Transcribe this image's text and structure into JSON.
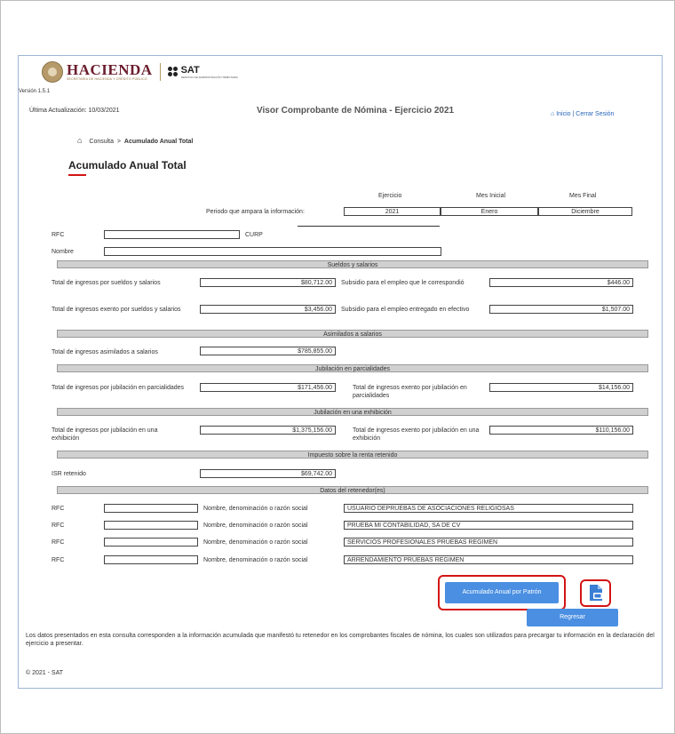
{
  "header": {
    "brand": "HACIENDA",
    "brand_sub": "SECRETARÍA DE HACIENDA Y CRÉDITO PÚBLICO",
    "sat": "SAT",
    "sat_sub": "SERVICIO DE ADMINISTRACIÓN TRIBUTARIA",
    "version": "Versión 1.5.1",
    "last_update": "Última Actualización: 10/03/2021",
    "app_title": "Visor Comprobante de Nómina - Ejercicio 2021",
    "inicio": "Inicio",
    "sep": "|",
    "cerrar": "Cerrar Sesión"
  },
  "breadcrumb": {
    "home": "Consulta",
    "current": "Acumulado Anual Total"
  },
  "page_title": "Acumulado Anual Total",
  "accent_color": "#d31414",
  "periodo": {
    "col_ejercicio": "Ejercicio",
    "col_mes_inicial": "Mes Inicial",
    "col_mes_final": "Mes Final",
    "label": "Periodo que ampara la información:",
    "ejercicio": "2021",
    "mes_inicial": "Enero",
    "mes_final": "Diciembre"
  },
  "contrib": {
    "rfc_label": "RFC",
    "rfc_value": "",
    "curp_label": "CURP",
    "curp_value": "",
    "nombre_label": "Nombre",
    "nombre_value": ""
  },
  "sueldos": {
    "title": "Sueldos y salarios",
    "total_label": "Total de ingresos por sueldos y salarios",
    "total_value": "$80,712.00",
    "subsidio_corr_label": "Subsidio para el empleo que le correspondió",
    "subsidio_corr_value": "$446.00",
    "exento_label": "Total de ingresos exento por sueldos y salarios",
    "exento_value": "$3,456.00",
    "subsidio_ent_label": "Subsidio para el empleo entregado en efectivo",
    "subsidio_ent_value": "$1,507.00"
  },
  "asimilados": {
    "title": "Asimilados a salarios",
    "total_label": "Total de ingresos asimilados a salarios",
    "total_value": "$785,855.00"
  },
  "jub_parc": {
    "title": "Jubilación en parcialidades",
    "total_label": "Total de ingresos por jubilación en parcialidades",
    "total_value": "$171,456.00",
    "exento_label": "Total de ingresos exento por jubilación en parcialidades",
    "exento_value": "$14,156.00"
  },
  "jub_exh": {
    "title": "Jubilación en una exhibición",
    "total_label": "Total de ingresos por jubilación en una exhibición",
    "total_value": "$1,375,156.00",
    "exento_label": "Total de ingresos exento por jubilación en una exhibición",
    "exento_value": "$110,156.00"
  },
  "isr": {
    "title": "Impuesto sobre la renta retenido",
    "label": "ISR retenido",
    "value": "$69,742.00"
  },
  "retenedores": {
    "title": "Datos del retenedor(es)",
    "rfc_label": "RFC",
    "nombre_label": "Nombre, denominación o razón social",
    "rows": [
      {
        "rfc": "",
        "nombre": "USUARIO DEPRUEBAS DE ASOCIACIONES RELIGIOSAS"
      },
      {
        "rfc": "",
        "nombre": "PRUEBA MI CONTABILIDAD, SA DE CV"
      },
      {
        "rfc": "",
        "nombre": "SERVICIOS PROFESIONALES PRUEBAS REGIMEN"
      },
      {
        "rfc": "",
        "nombre": "ARRENDAMIENTO PRUEBAS REGIMEN"
      }
    ]
  },
  "buttons": {
    "acumulado_patron": "Acumulado Anual por Patrón",
    "regresar": "Regresar",
    "pdf_icon": "pdf-file-icon"
  },
  "footer": {
    "note": "Los datos presentados en esta consulta corresponden a la información acumulada que manifestó tu retenedor en los comprobantes fiscales de nómina, los cuales son utilizados para precargar tu información en la declaración del ejercicio a presentar.",
    "copyright": "© 2021 - SAT"
  }
}
